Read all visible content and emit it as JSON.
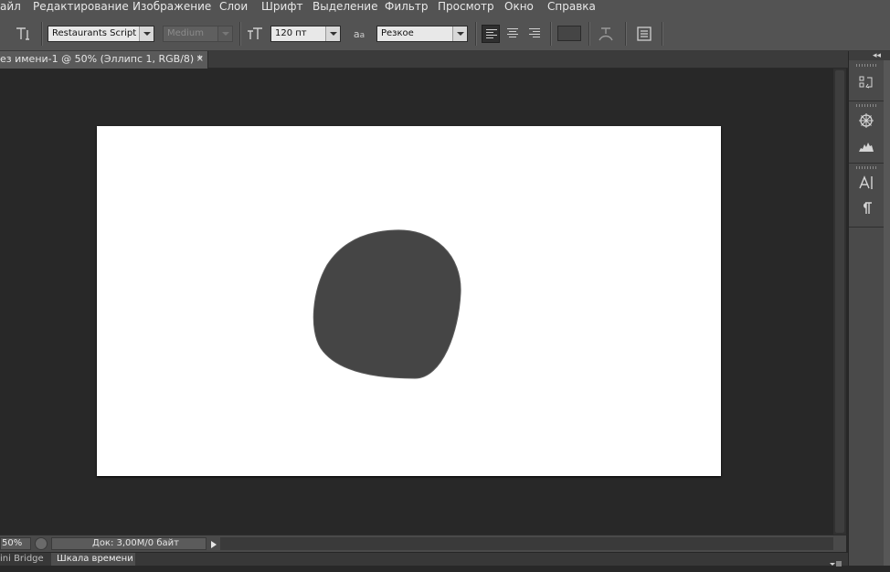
{
  "menu": [
    "айл",
    "Редактирование",
    "Изображение",
    "Слои",
    "Шрифт",
    "Выделение",
    "Фильтр",
    "Просмотр",
    "Окно",
    "Справка"
  ],
  "options_bar": {
    "font_family": "Restaurants Script",
    "font_style": "Medium",
    "font_size": "120 пт",
    "antialias": "Резкое",
    "icons": {
      "tool_preset": "type-tool-icon",
      "orientation": "text-orientation-icon",
      "size_icon": "font-size-icon",
      "antialias_icon": "antialias-icon",
      "warp": "warp-text-icon",
      "panels": "character-panel-icon"
    }
  },
  "document_tab": {
    "title": "ез имени-1 @ 50% (Эллипс 1, RGB/8) *",
    "close": "×"
  },
  "canvas": {
    "shape_color": "#454545",
    "background_color": "#ffffff"
  },
  "status_bar": {
    "zoom": "50%",
    "doc_info": "Док: 3,00M/0 байт"
  },
  "bottom_tabs": [
    "ini Bridge",
    "Шкала времени"
  ],
  "right_dock": {
    "collapse": "◂◂",
    "icons": [
      "history-icon",
      "navigator-icon",
      "histogram-icon",
      "character-icon",
      "paragraph-icon"
    ]
  },
  "colors": {
    "ui_bg": "#535353",
    "workspace": "#282828",
    "accent_active": "#2f2f2f"
  }
}
